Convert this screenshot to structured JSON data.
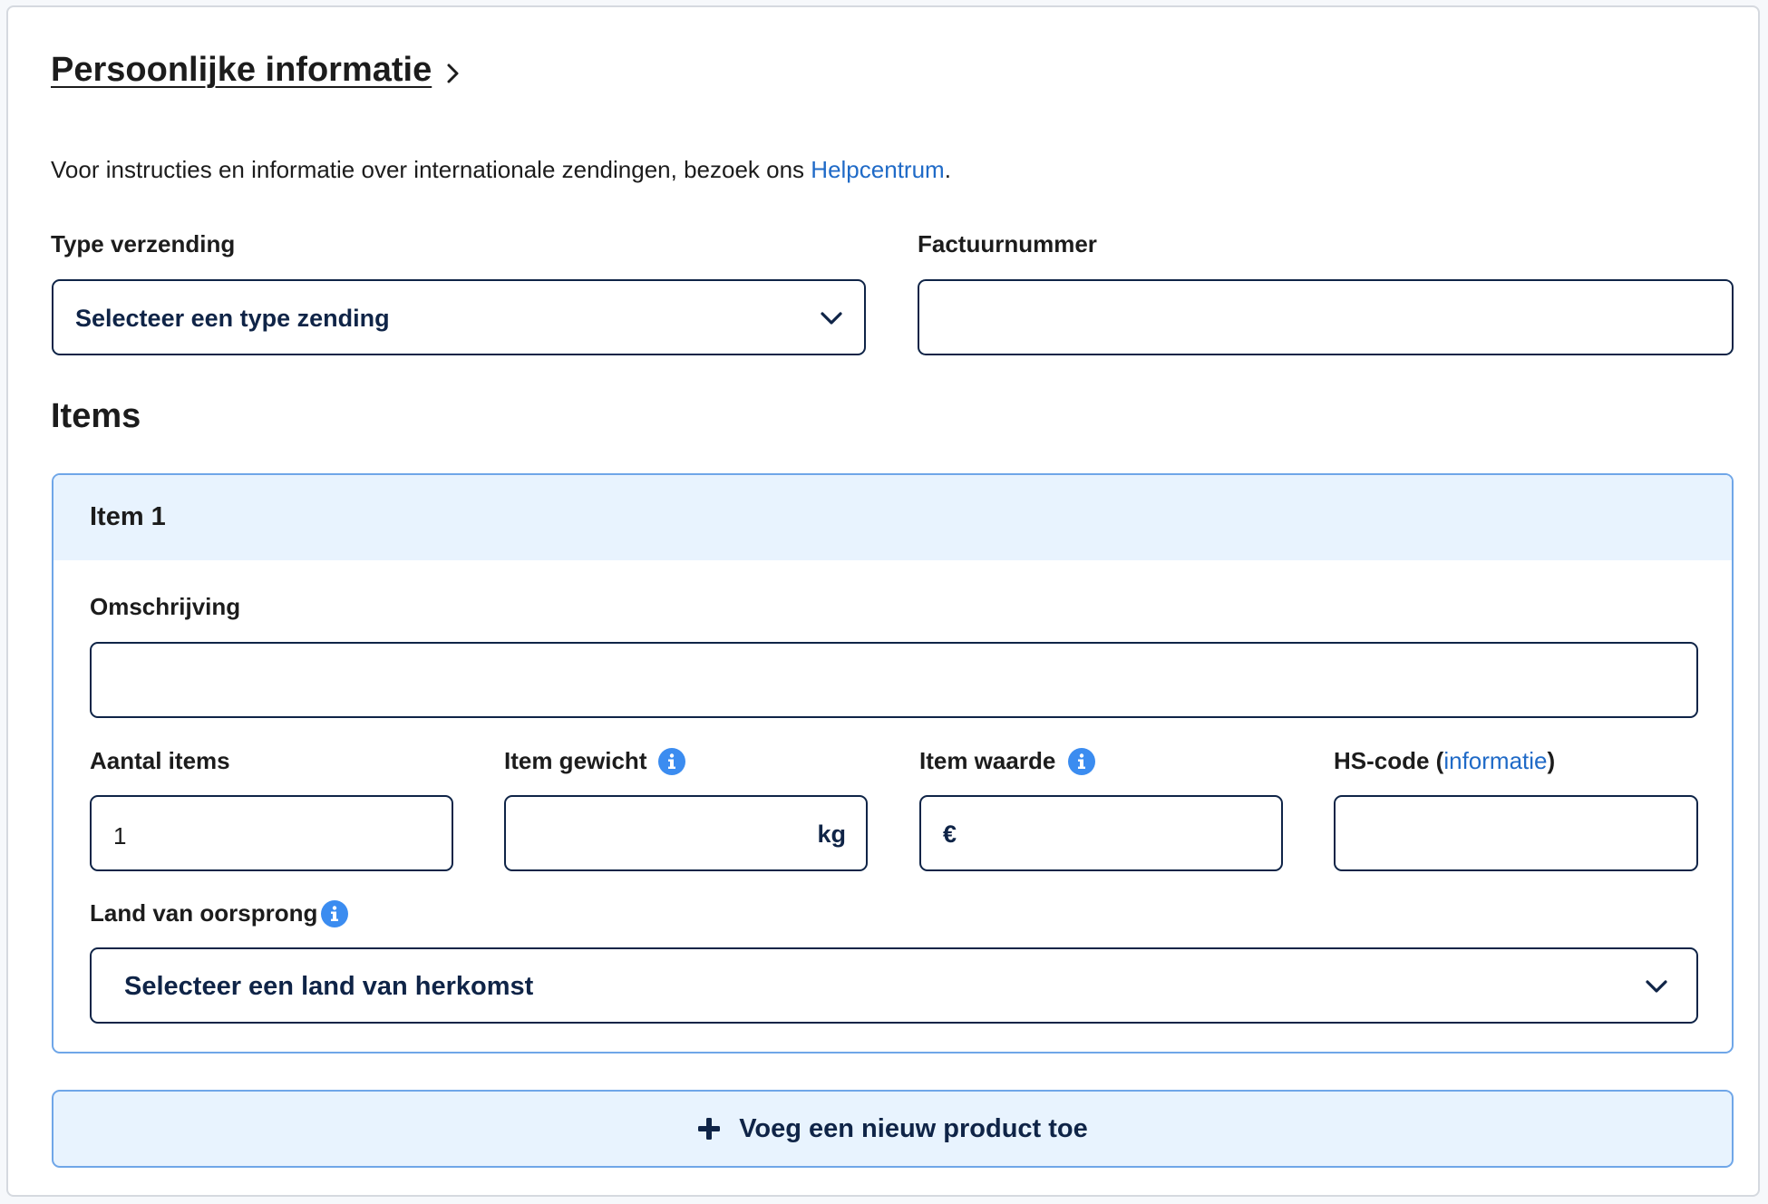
{
  "header": {
    "title": "Persoonlijke informatie",
    "intro_text": "Voor instructies en informatie over internationale zendingen, bezoek ons ",
    "help_link": "Helpcentrum",
    "intro_suffix": "."
  },
  "shipment": {
    "type_label": "Type verzending",
    "type_placeholder": "Selecteer een type zending",
    "invoice_label": "Factuurnummer",
    "invoice_value": ""
  },
  "items_section": {
    "title": "Items",
    "items": [
      {
        "title": "Item 1",
        "description_label": "Omschrijving",
        "description_value": "",
        "quantity_label": "Aantal items",
        "quantity_value": "1",
        "weight_label": "Item gewicht",
        "weight_unit": "kg",
        "value_label": "Item waarde",
        "value_currency": "€",
        "hs_label": "HS-code (",
        "hs_link": "informatie",
        "hs_label_end": ")",
        "origin_label": "Land van oorsprong",
        "origin_placeholder": "Selecteer een land van herkomst"
      }
    ],
    "add_button": "Voeg een nieuw product toe"
  },
  "colors": {
    "accent_link": "#1f6ac7",
    "field_border": "#0f2447",
    "item_border": "#6fa6e8",
    "item_header_bg": "#e8f3fe",
    "info_icon": "#3b8cf0"
  },
  "icons": {
    "breadcrumb": "chevron-right-icon",
    "select": "chevron-down-icon",
    "info": "info-icon",
    "add": "plus-icon"
  }
}
